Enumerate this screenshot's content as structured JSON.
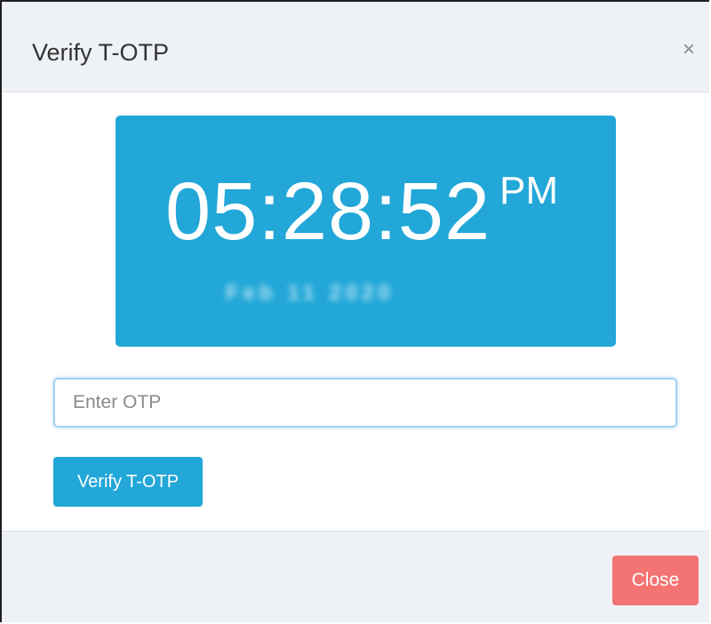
{
  "dialog": {
    "title": "Verify T-OTP",
    "close_icon": "×"
  },
  "clock": {
    "time": "05:28:52",
    "ampm": "PM",
    "date_blurred": "Feb 11 2020"
  },
  "otp": {
    "placeholder": "Enter OTP",
    "value": ""
  },
  "actions": {
    "verify_label": "Verify T-OTP",
    "close_label": "Close"
  },
  "colors": {
    "accent": "#22a7d8",
    "close_button": "#f47373",
    "header_bg": "#eef1f5"
  }
}
